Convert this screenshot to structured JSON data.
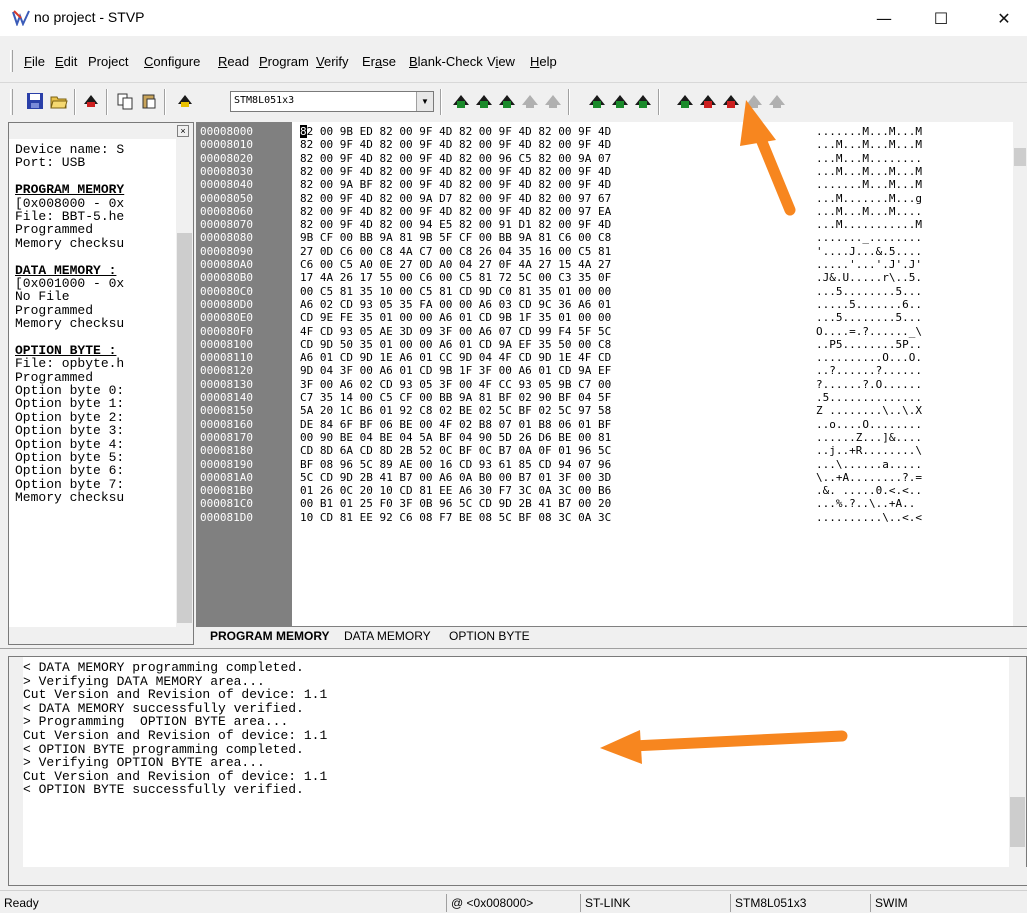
{
  "window": {
    "title": "no project - STVP",
    "minimize": "—",
    "maximize": "☐",
    "close": "✕"
  },
  "menu": [
    "File",
    "Edit",
    "Project",
    "Configure",
    "Read",
    "Program",
    "Verify",
    "Erase",
    "Blank-Check",
    "View",
    "Help"
  ],
  "menu_underline": [
    "F",
    "E",
    "j",
    "C",
    "R",
    "P",
    "V",
    "a",
    "B",
    "i",
    "H"
  ],
  "toolbar": {
    "device": "STM8L051x3",
    "icons": [
      "save-icon",
      "open-icon",
      "program-icon",
      "copy-icon",
      "paste-icon",
      "device-icon",
      "read-icon",
      "read-current-icon",
      "read-all-icon",
      "read-disabled-icon",
      "read-disabled2-icon",
      "program-icon",
      "program-current-icon",
      "program-all-icon",
      "verify-icon",
      "verify-current-icon",
      "verify-all-icon",
      "verify-disabled-icon"
    ]
  },
  "info_panel": {
    "lines": [
      {
        "text": "Device name: S",
        "heading": false
      },
      {
        "text": "Port: USB",
        "heading": false
      },
      {
        "text": "",
        "heading": false
      },
      {
        "text": "PROGRAM MEMORY",
        "heading": true
      },
      {
        "text": "[0x008000 - 0x",
        "heading": false
      },
      {
        "text": "File: BBT-5.he",
        "heading": false
      },
      {
        "text": "Programmed",
        "heading": false
      },
      {
        "text": "Memory checksu",
        "heading": false
      },
      {
        "text": "",
        "heading": false
      },
      {
        "text": "DATA MEMORY :",
        "heading": true
      },
      {
        "text": "[0x001000 - 0x",
        "heading": false
      },
      {
        "text": "No File",
        "heading": false
      },
      {
        "text": "Programmed",
        "heading": false
      },
      {
        "text": "Memory checksu",
        "heading": false
      },
      {
        "text": "",
        "heading": false
      },
      {
        "text": "OPTION BYTE :",
        "heading": true
      },
      {
        "text": "File: opbyte.h",
        "heading": false
      },
      {
        "text": "Programmed",
        "heading": false
      },
      {
        "text": "Option byte 0:",
        "heading": false
      },
      {
        "text": "Option byte 1:",
        "heading": false
      },
      {
        "text": "Option byte 2:",
        "heading": false
      },
      {
        "text": "Option byte 3:",
        "heading": false
      },
      {
        "text": "Option byte 4:",
        "heading": false
      },
      {
        "text": "Option byte 5:",
        "heading": false
      },
      {
        "text": "Option byte 6:",
        "heading": false
      },
      {
        "text": "Option byte 7:",
        "heading": false
      },
      {
        "text": "Memory checksu",
        "heading": false
      }
    ]
  },
  "hex": {
    "rows": [
      {
        "addr": "00008000",
        "bytes": "82 00 9B ED 82 00 9F 4D 82 00 9F 4D 82 00 9F 4D",
        "ascii": ".......M...M...M"
      },
      {
        "addr": "00008010",
        "bytes": "82 00 9F 4D 82 00 9F 4D 82 00 9F 4D 82 00 9F 4D",
        "ascii": "...M...M...M...M"
      },
      {
        "addr": "00008020",
        "bytes": "82 00 9F 4D 82 00 9F 4D 82 00 96 C5 82 00 9A 07",
        "ascii": "...M...M........"
      },
      {
        "addr": "00008030",
        "bytes": "82 00 9F 4D 82 00 9F 4D 82 00 9F 4D 82 00 9F 4D",
        "ascii": "...M...M...M...M"
      },
      {
        "addr": "00008040",
        "bytes": "82 00 9A BF 82 00 9F 4D 82 00 9F 4D 82 00 9F 4D",
        "ascii": ".......M...M...M"
      },
      {
        "addr": "00008050",
        "bytes": "82 00 9F 4D 82 00 9A D7 82 00 9F 4D 82 00 97 67",
        "ascii": "...M.......M...g"
      },
      {
        "addr": "00008060",
        "bytes": "82 00 9F 4D 82 00 9F 4D 82 00 9F 4D 82 00 97 EA",
        "ascii": "...M...M...M...."
      },
      {
        "addr": "00008070",
        "bytes": "82 00 9F 4D 82 00 94 E5 82 00 91 D1 82 00 9F 4D",
        "ascii": "...M...........M"
      },
      {
        "addr": "00008080",
        "bytes": "9B CF 00 BB 9A 81 9B 5F CF 00 BB 9A 81 C6 00 C8",
        "ascii": "......._........"
      },
      {
        "addr": "00008090",
        "bytes": "27 0D C6 00 C8 4A C7 00 C8 26 04 35 16 00 C5 81",
        "ascii": "'....J...&.5...."
      },
      {
        "addr": "000080A0",
        "bytes": "C6 00 C5 A0 0E 27 0D A0 04 27 0F 4A 27 15 4A 27",
        "ascii": ".....'...'.J'.J'"
      },
      {
        "addr": "000080B0",
        "bytes": "17 4A 26 17 55 00 C6 00 C5 81 72 5C 00 C3 35 0F",
        "ascii": ".J&.U.....r\\..5."
      },
      {
        "addr": "000080C0",
        "bytes": "00 C5 81 35 10 00 C5 81 CD 9D C0 81 35 01 00 00",
        "ascii": "...5........5..."
      },
      {
        "addr": "000080D0",
        "bytes": "A6 02 CD 93 05 35 FA 00 00 A6 03 CD 9C 36 A6 01",
        "ascii": ".....5.......6.."
      },
      {
        "addr": "000080E0",
        "bytes": "CD 9E FE 35 01 00 00 A6 01 CD 9B 1F 35 01 00 00",
        "ascii": "...5........5..."
      },
      {
        "addr": "000080F0",
        "bytes": "4F CD 93 05 AE 3D 09 3F 00 A6 07 CD 99 F4 5F 5C",
        "ascii": "O....=.?......_\\"
      },
      {
        "addr": "00008100",
        "bytes": "CD 9D 50 35 01 00 00 A6 01 CD 9A EF 35 50 00 C8",
        "ascii": "..P5........5P.."
      },
      {
        "addr": "00008110",
        "bytes": "A6 01 CD 9D 1E A6 01 CC 9D 04 4F CD 9D 1E 4F CD",
        "ascii": "..........O...O."
      },
      {
        "addr": "00008120",
        "bytes": "9D 04 3F 00 A6 01 CD 9B 1F 3F 00 A6 01 CD 9A EF",
        "ascii": "..?......?......"
      },
      {
        "addr": "00008130",
        "bytes": "3F 00 A6 02 CD 93 05 3F 00 4F CC 93 05 9B C7 00",
        "ascii": "?......?.O......"
      },
      {
        "addr": "00008140",
        "bytes": "C7 35 14 00 C5 CF 00 BB 9A 81 BF 02 90 BF 04 5F",
        "ascii": ".5.............."
      },
      {
        "addr": "00008150",
        "bytes": "5A 20 1C B6 01 92 C8 02 BE 02 5C BF 02 5C 97 58",
        "ascii": "Z ........\\..\\.X"
      },
      {
        "addr": "00008160",
        "bytes": "DE 84 6F BF 06 BE 00 4F 02 B8 07 01 B8 06 01 BF",
        "ascii": "..o....O........"
      },
      {
        "addr": "00008170",
        "bytes": "00 90 BE 04 BE 04 5A BF 04 90 5D 26 D6 BE 00 81",
        "ascii": "......Z...]&...."
      },
      {
        "addr": "00008180",
        "bytes": "CD 8D 6A CD 8D 2B 52 0C BF 0C B7 0A 0F 01 96 5C",
        "ascii": "..j..+R........\\"
      },
      {
        "addr": "00008190",
        "bytes": "BF 08 96 5C 89 AE 00 16 CD 93 61 85 CD 94 07 96",
        "ascii": "...\\......a....."
      },
      {
        "addr": "000081A0",
        "bytes": "5C CD 9D 2B 41 B7 00 A6 0A B0 00 B7 01 3F 00 3D",
        "ascii": "\\..+A........?.="
      },
      {
        "addr": "000081B0",
        "bytes": "01 26 0C 20 10 CD 81 EE A6 30 F7 3C 0A 3C 00 B6",
        "ascii": ".&. .....0.<.<.."
      },
      {
        "addr": "000081C0",
        "bytes": "00 B1 01 25 F0 3F 0B 96 5C CD 9D 2B 41 B7 00 20",
        "ascii": "...%.?..\\..+A.. "
      },
      {
        "addr": "000081D0",
        "bytes": "10 CD 81 EE 92 C6 08 F7 BE 08 5C BF 08 3C 0A 3C",
        "ascii": "..........\\..<.<"
      }
    ]
  },
  "tabs": [
    "PROGRAM MEMORY",
    "DATA MEMORY",
    "OPTION BYTE"
  ],
  "log": [
    "< DATA MEMORY programming completed.",
    "> Verifying DATA MEMORY area...",
    "Cut Version and Revision of device: 1.1",
    "< DATA MEMORY successfully verified.",
    "> Programming  OPTION BYTE area...",
    "Cut Version and Revision of device: 1.1",
    "< OPTION BYTE programming completed.",
    "> Verifying OPTION BYTE area...",
    "Cut Version and Revision of device: 1.1",
    "< OPTION BYTE successfully verified."
  ],
  "status": {
    "ready": "Ready",
    "address": "@ <0x008000>",
    "link": "ST-LINK",
    "device": "STM8L051x3",
    "protocol": "SWIM"
  },
  "colors": {
    "annotation_arrow": "#f7861f",
    "address_bg": "#808080",
    "toolbar_green": "#1a8a2a",
    "toolbar_red": "#cc1f1f"
  }
}
